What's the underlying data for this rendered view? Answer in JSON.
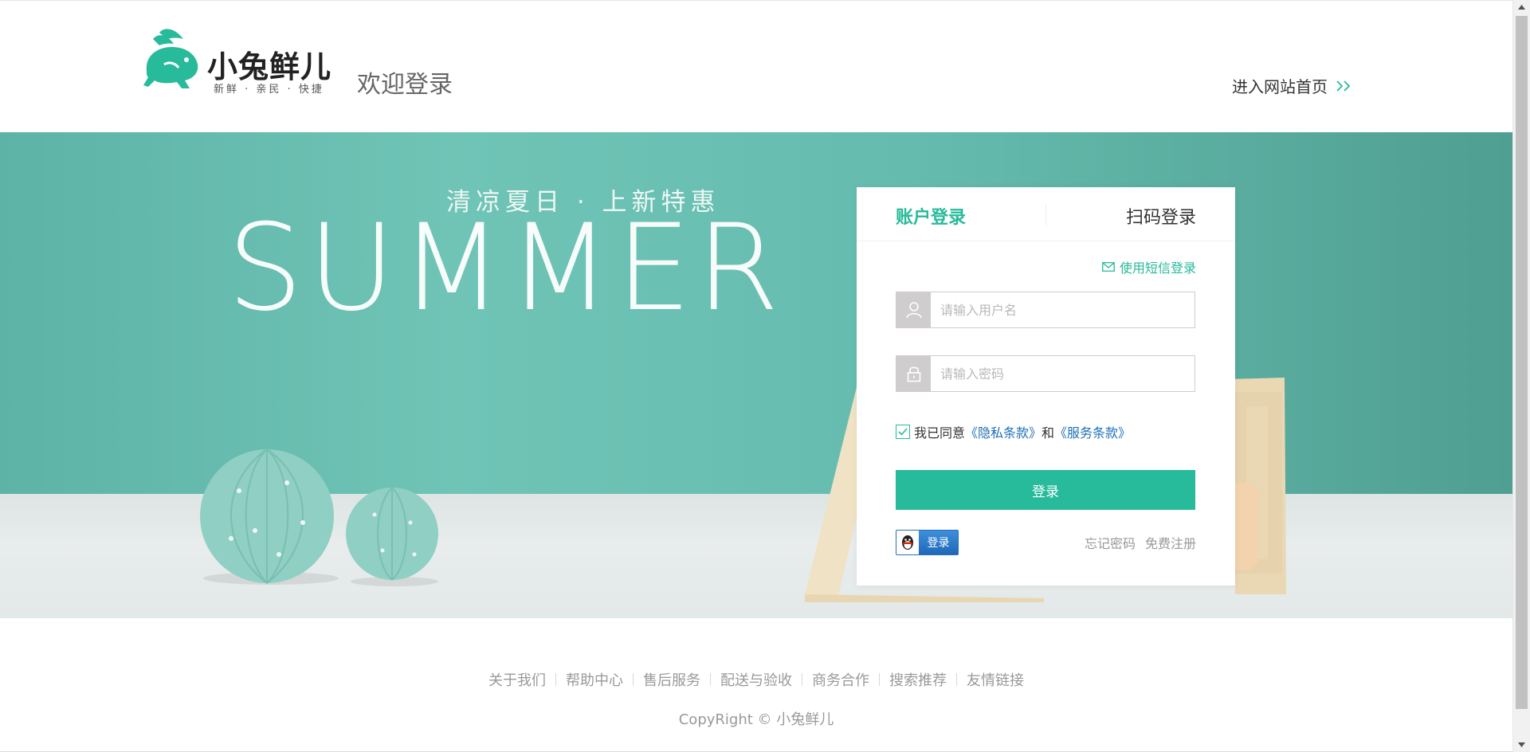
{
  "header": {
    "brand_name": "小兔鲜儿",
    "brand_slogan": "新鲜 · 亲民 · 快捷",
    "welcome_text": "欢迎登录",
    "home_link_label": "进入网站首页"
  },
  "banner": {
    "slogan": "清凉夏日 · 上新特惠",
    "title": "SUMMER"
  },
  "login": {
    "tabs": [
      {
        "label": "账户登录",
        "active": true
      },
      {
        "label": "扫码登录",
        "active": false
      }
    ],
    "sms_link_label": "使用短信登录",
    "username_placeholder": "请输入用户名",
    "password_placeholder": "请输入密码",
    "agree_prefix": "我已同意",
    "privacy_link": "《隐私条款》",
    "agree_and": "和",
    "service_link": "《服务条款》",
    "agree_checked": true,
    "submit_label": "登录",
    "qq_login_label": "登录",
    "forgot_password_label": "忘记密码",
    "register_label": "免费注册"
  },
  "footer": {
    "links": [
      "关于我们",
      "帮助中心",
      "售后服务",
      "配送与验收",
      "商务合作",
      "搜索推荐",
      "友情链接"
    ],
    "copyright": "CopyRight © 小兔鲜儿"
  },
  "colors": {
    "accent": "#27ba9b",
    "link_blue": "#1d6fb8",
    "muted": "#999999"
  },
  "icons": {
    "logo": "rabbit-logo-icon",
    "home_arrow": "double-chevron-right-icon",
    "sms": "envelope-icon",
    "username": "user-icon",
    "password": "lock-icon",
    "checkbox": "checkmark-icon",
    "qq": "qq-penguin-icon"
  }
}
